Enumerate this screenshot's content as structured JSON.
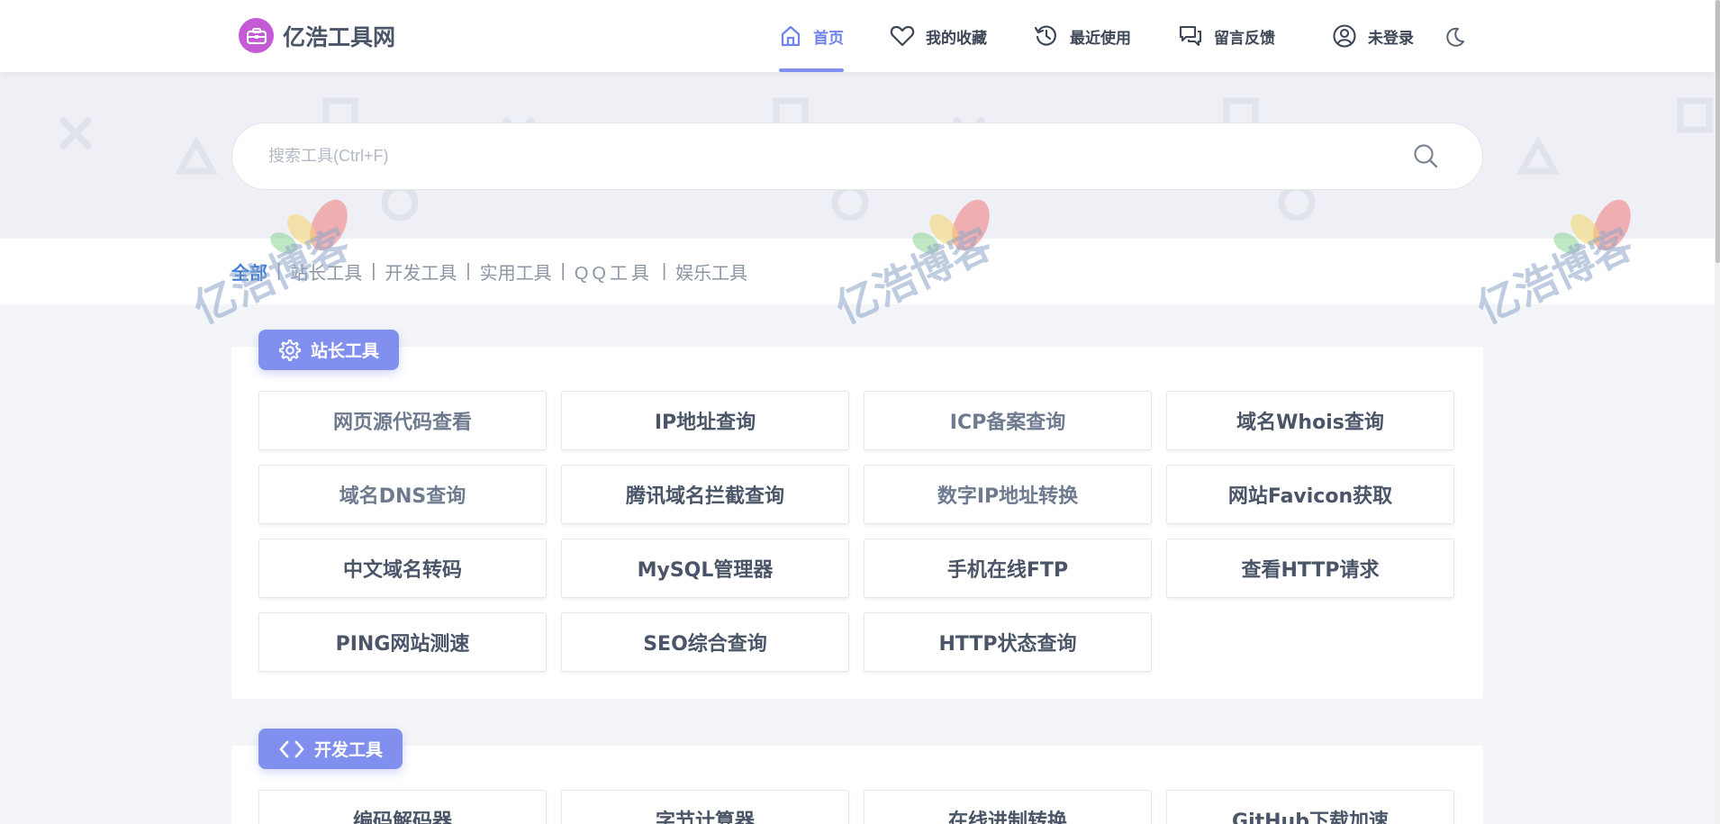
{
  "site": {
    "name": "亿浩工具网"
  },
  "nav": {
    "items": [
      {
        "label": "首页",
        "icon": "home-icon",
        "active": true
      },
      {
        "label": "我的收藏",
        "icon": "heart-icon",
        "active": false
      },
      {
        "label": "最近使用",
        "icon": "history-icon",
        "active": false
      },
      {
        "label": "留言反馈",
        "icon": "chat-icon",
        "active": false
      },
      {
        "label": "未登录",
        "icon": "user-icon",
        "active": false
      }
    ],
    "theme_toggle": "moon-icon"
  },
  "search": {
    "placeholder": "搜索工具(Ctrl+F)",
    "value": ""
  },
  "categories": [
    "全部",
    "站长工具",
    "开发工具",
    "实用工具",
    "QQ工具",
    "娱乐工具"
  ],
  "active_category": "全部",
  "sections": [
    {
      "title": "站长工具",
      "icon": "gear-icon",
      "tools": [
        "网页源代码查看",
        "IP地址查询",
        "ICP备案查询",
        "域名Whois查询",
        "域名DNS查询",
        "腾讯域名拦截查询",
        "数字IP地址转换",
        "网站Favicon获取",
        "中文域名转码",
        "MySQL管理器",
        "手机在线FTP",
        "查看HTTP请求",
        "PING网站测速",
        "SEO综合查询",
        "HTTP状态查询"
      ]
    },
    {
      "title": "开发工具",
      "icon": "code-icon",
      "tools": [
        "编码解码器",
        "字节计算器",
        "在线进制转换",
        "GitHub下载加速"
      ]
    }
  ],
  "watermark": {
    "text": "亿浩博客"
  },
  "colors": {
    "accent": "#8190ef",
    "active_nav": "#6f82ee",
    "active_category": "#3e7ed6",
    "logo": "#c45ad6",
    "background": "#f4f5f9"
  }
}
